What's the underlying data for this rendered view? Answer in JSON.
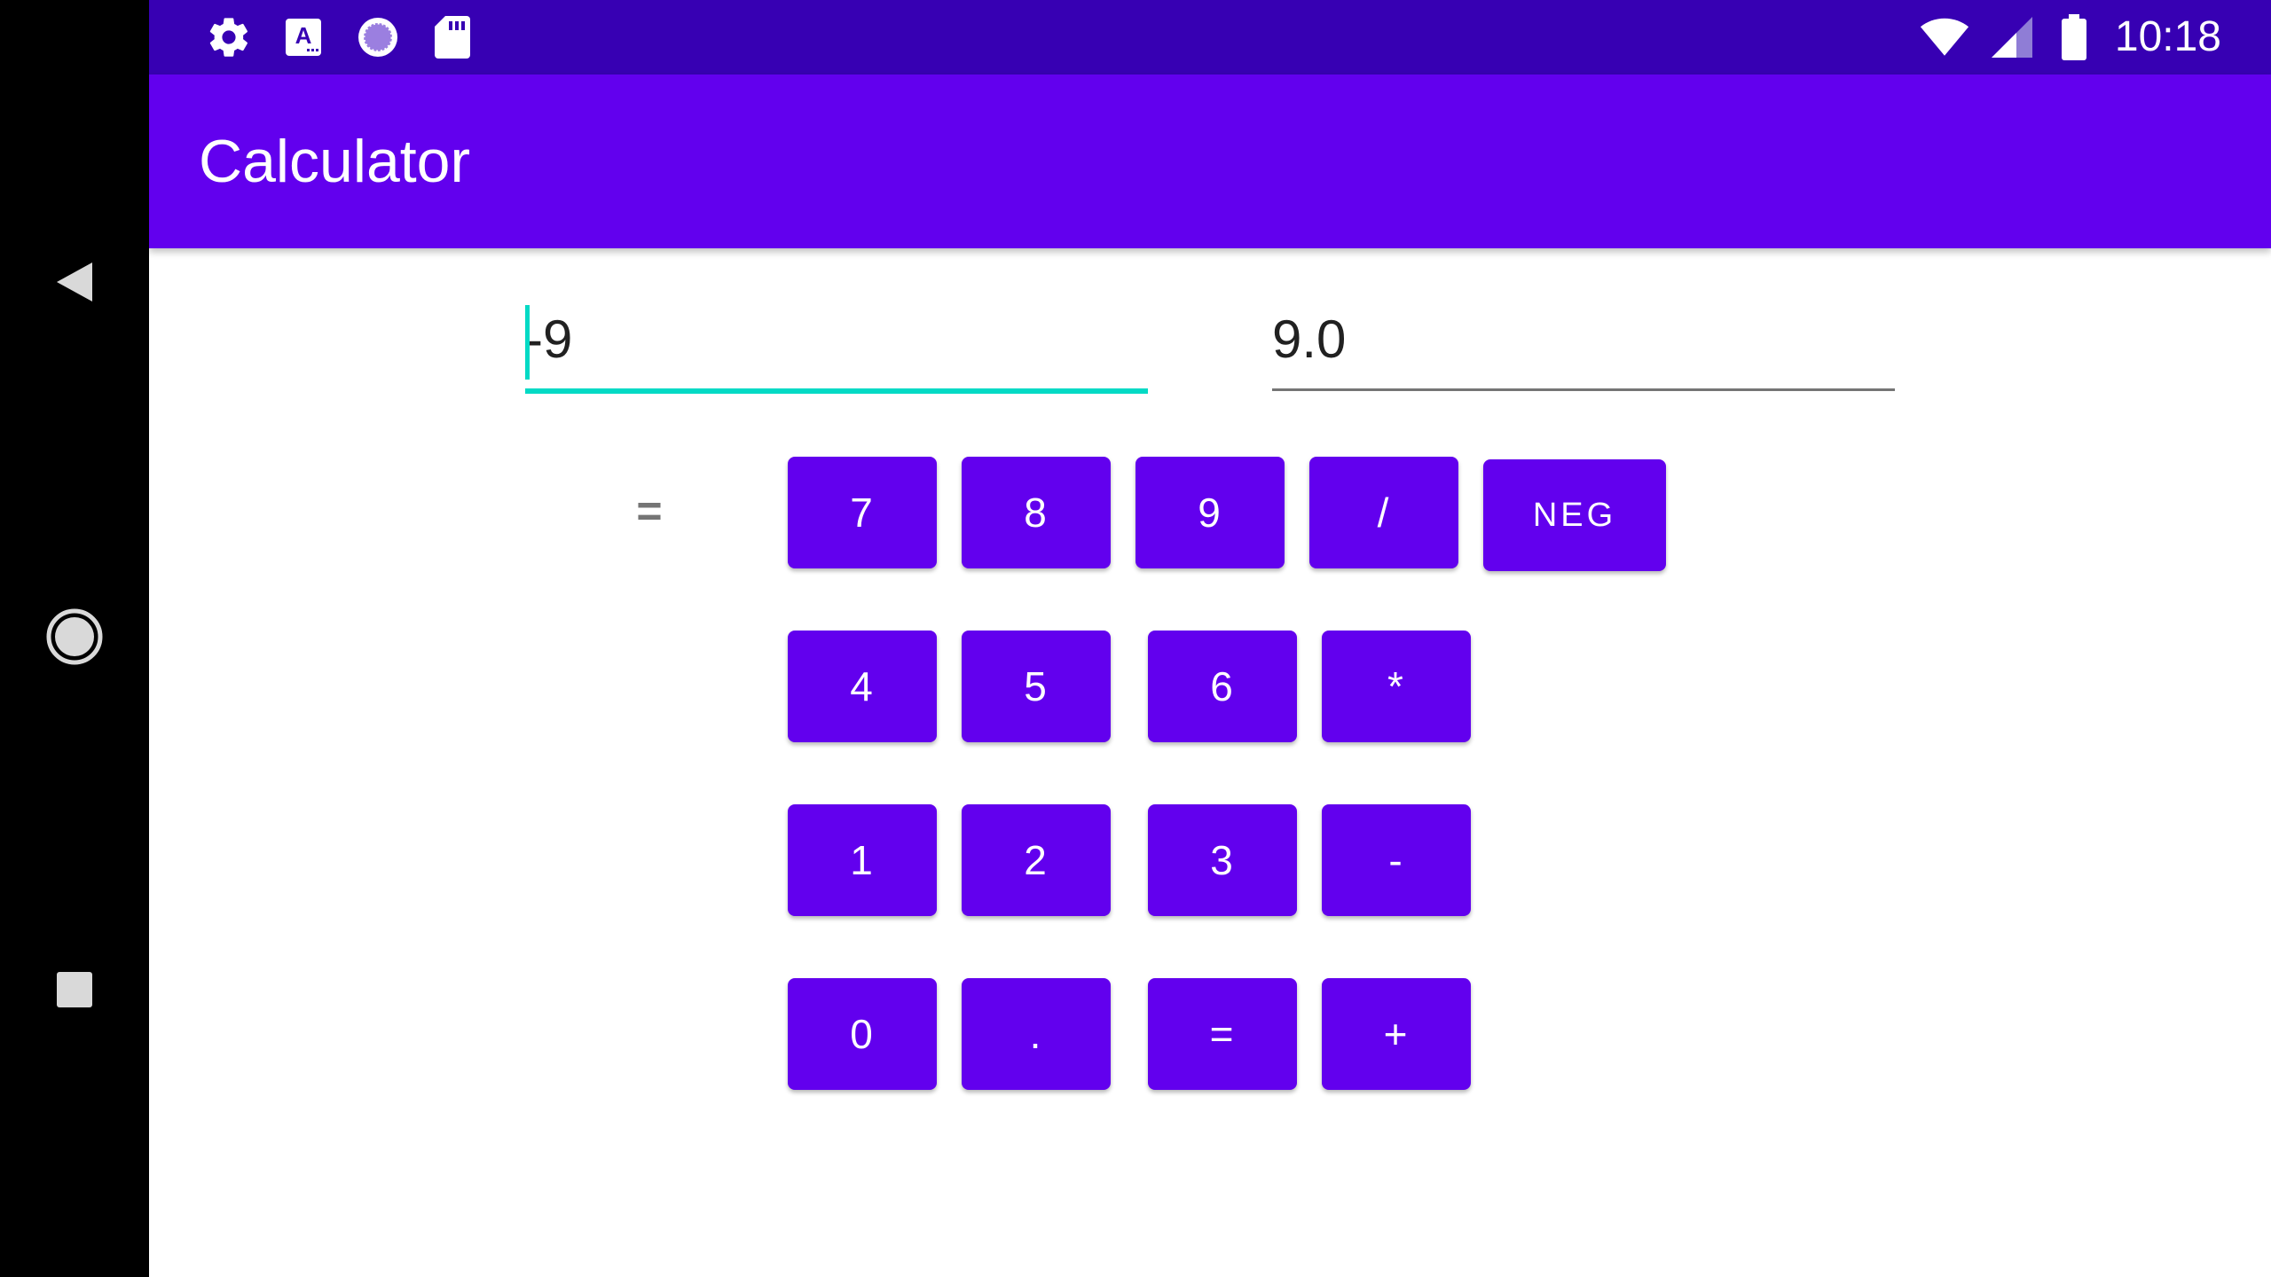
{
  "status_bar": {
    "time": "10:18",
    "icons": [
      "settings-icon",
      "keyboard-a-icon",
      "sync-icon",
      "sd-card-icon",
      "wifi-icon",
      "signal-icon",
      "battery-icon"
    ]
  },
  "app_bar": {
    "title": "Calculator"
  },
  "inputs": {
    "operand_value": "-9",
    "result_value": "9.0"
  },
  "equals_label": "=",
  "keypad": {
    "row1": [
      "7",
      "8",
      "9",
      "/",
      "NEG"
    ],
    "row2": [
      "4",
      "5",
      "6",
      "*"
    ],
    "row3": [
      "1",
      "2",
      "3",
      "-"
    ],
    "row4": [
      "0",
      ".",
      "=",
      "+"
    ]
  },
  "navigation": {
    "icons": [
      "back-icon",
      "home-icon",
      "recents-icon"
    ]
  },
  "colors": {
    "primary": "#6200ee",
    "primary_dark": "#3700b3",
    "accent": "#03dac5"
  }
}
